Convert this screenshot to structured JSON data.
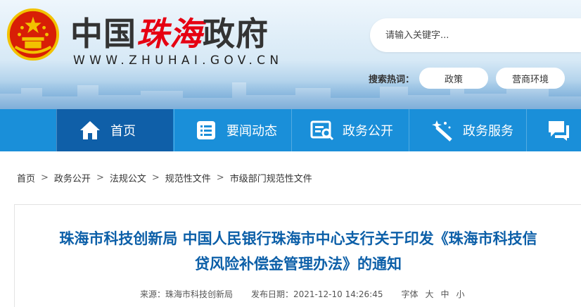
{
  "header": {
    "title_part1": "中国",
    "title_part2": "珠海",
    "title_part3": "政府",
    "url": "WWW.ZHUHAI.GOV.CN",
    "search_placeholder": "请输入关键字...",
    "hot_label": "搜索热词：",
    "hot_words": [
      "政策",
      "营商环境"
    ]
  },
  "nav": {
    "items": [
      {
        "label": "首页",
        "icon": "home-icon"
      },
      {
        "label": "要闻动态",
        "icon": "news-list-icon"
      },
      {
        "label": "政务公开",
        "icon": "search-document-icon"
      },
      {
        "label": "政务服务",
        "icon": "magic-wand-icon"
      },
      {
        "label": "",
        "icon": "chat-icon"
      }
    ]
  },
  "breadcrumb": [
    "首页",
    "政务公开",
    "法规公文",
    "规范性文件",
    "市级部门规范性文件"
  ],
  "article": {
    "title_line1": "珠海市科技创新局 中国人民银行珠海市中心支行关于印发《珠海市科技信",
    "title_line2": "贷风险补偿金管理办法》的通知",
    "source": "来源：珠海市科技创新局",
    "published": "发布日期：2021-12-10 14:26:45",
    "font_label": "字体",
    "font_sizes": [
      "大",
      "中",
      "小"
    ]
  },
  "colors": {
    "nav_bg": "#1a8fd9",
    "nav_active_bg": "#0f5fa8",
    "title_blue": "#0c5fa8",
    "brand_red": "#e60012"
  }
}
